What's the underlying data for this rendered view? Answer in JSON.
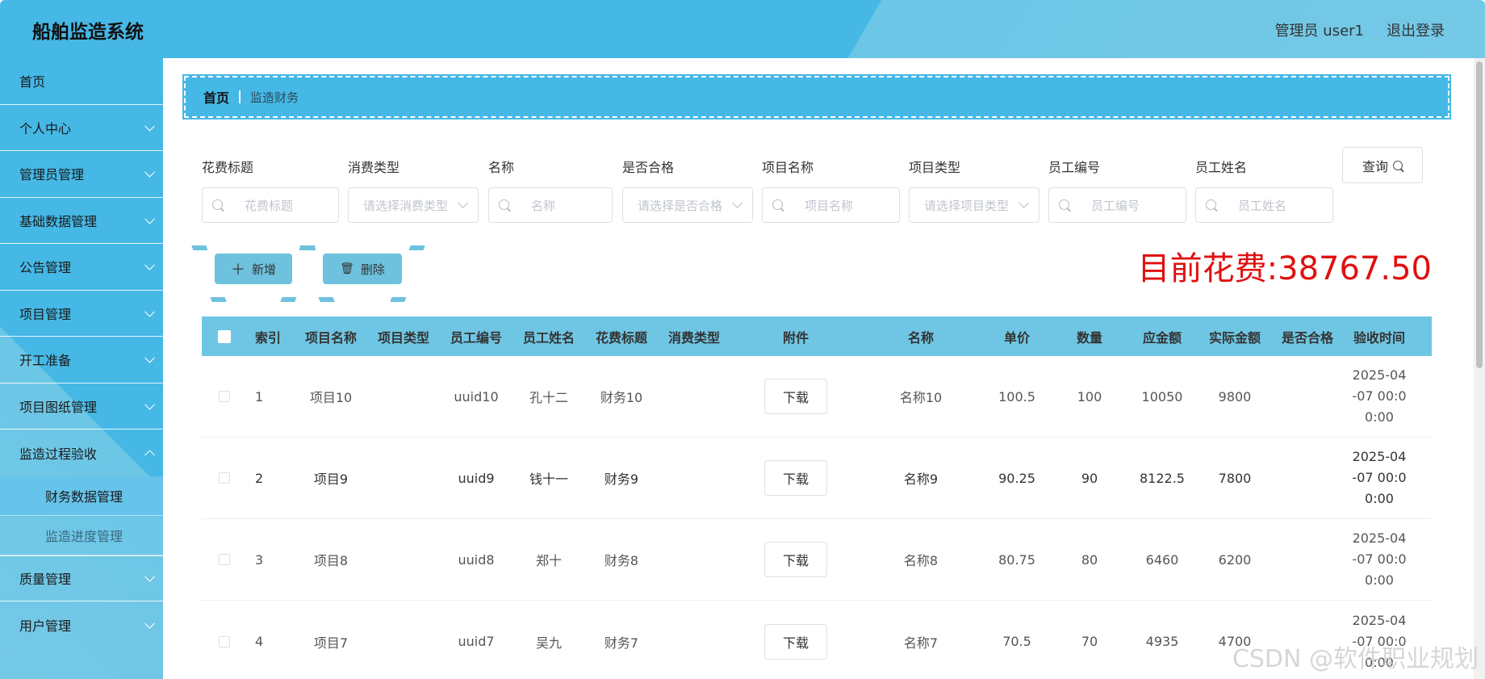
{
  "header": {
    "title": "船舶监造系统",
    "user": "管理员 user1",
    "logout": "退出登录"
  },
  "sidebar": {
    "items": [
      {
        "label": "首页"
      },
      {
        "label": "个人中心"
      },
      {
        "label": "管理员管理"
      },
      {
        "label": "基础数据管理"
      },
      {
        "label": "公告管理"
      },
      {
        "label": "项目管理"
      },
      {
        "label": "开工准备"
      },
      {
        "label": "项目图纸管理"
      },
      {
        "label": "监造过程验收"
      },
      {
        "label": "质量管理"
      },
      {
        "label": "用户管理"
      }
    ],
    "submenu": [
      {
        "label": "财务数据管理"
      },
      {
        "label": "监造进度管理"
      }
    ]
  },
  "breadcrumb": {
    "home": "首页",
    "current": "监造财务"
  },
  "filters": [
    {
      "label": "花费标题",
      "placeholder": "花费标题"
    },
    {
      "label": "消费类型",
      "placeholder": "请选择消费类型"
    },
    {
      "label": "名称",
      "placeholder": "名称"
    },
    {
      "label": "是否合格",
      "placeholder": "请选择是否合格"
    },
    {
      "label": "项目名称",
      "placeholder": "项目名称"
    },
    {
      "label": "项目类型",
      "placeholder": "请选择项目类型"
    },
    {
      "label": "员工编号",
      "placeholder": "员工编号"
    },
    {
      "label": "员工姓名",
      "placeholder": "员工姓名"
    }
  ],
  "query_label": "查询",
  "add_label": "新增",
  "delete_label": "删除",
  "spend": "目前花费:38767.50",
  "table": {
    "headers": [
      "索引",
      "项目名称",
      "项目类型",
      "员工编号",
      "员工姓名",
      "花费标题",
      "消费类型",
      "附件",
      "名称",
      "单价",
      "数量",
      "应金额",
      "实际金额",
      "是否合格",
      "验收时间"
    ],
    "download_label": "下载",
    "rows": [
      {
        "index": "1",
        "project": "项目10",
        "type": "",
        "emp_no": "uuid10",
        "emp_name": "孔十二",
        "title": "财务10",
        "spend_type": "",
        "name": "名称10",
        "price": "100.5",
        "qty": "100",
        "due": "10050",
        "actual": "9800",
        "pass": "",
        "time1": "2025-04",
        "time2": "-07 00:0",
        "time3": "0:00"
      },
      {
        "index": "2",
        "project": "项目9",
        "type": "",
        "emp_no": "uuid9",
        "emp_name": "钱十一",
        "title": "财务9",
        "spend_type": "",
        "name": "名称9",
        "price": "90.25",
        "qty": "90",
        "due": "8122.5",
        "actual": "7800",
        "pass": "",
        "time1": "2025-04",
        "time2": "-07 00:0",
        "time3": "0:00"
      },
      {
        "index": "3",
        "project": "项目8",
        "type": "",
        "emp_no": "uuid8",
        "emp_name": "郑十",
        "title": "财务8",
        "spend_type": "",
        "name": "名称8",
        "price": "80.75",
        "qty": "80",
        "due": "6460",
        "actual": "6200",
        "pass": "",
        "time1": "2025-04",
        "time2": "-07 00:0",
        "time3": "0:00"
      },
      {
        "index": "4",
        "project": "项目7",
        "type": "",
        "emp_no": "uuid7",
        "emp_name": "吴九",
        "title": "财务7",
        "spend_type": "",
        "name": "名称7",
        "price": "70.5",
        "qty": "70",
        "due": "4935",
        "actual": "4700",
        "pass": "",
        "time1": "2025-04",
        "time2": "-07 00:0",
        "time3": "0:00"
      }
    ]
  },
  "watermark": "CSDN @软件职业规划"
}
